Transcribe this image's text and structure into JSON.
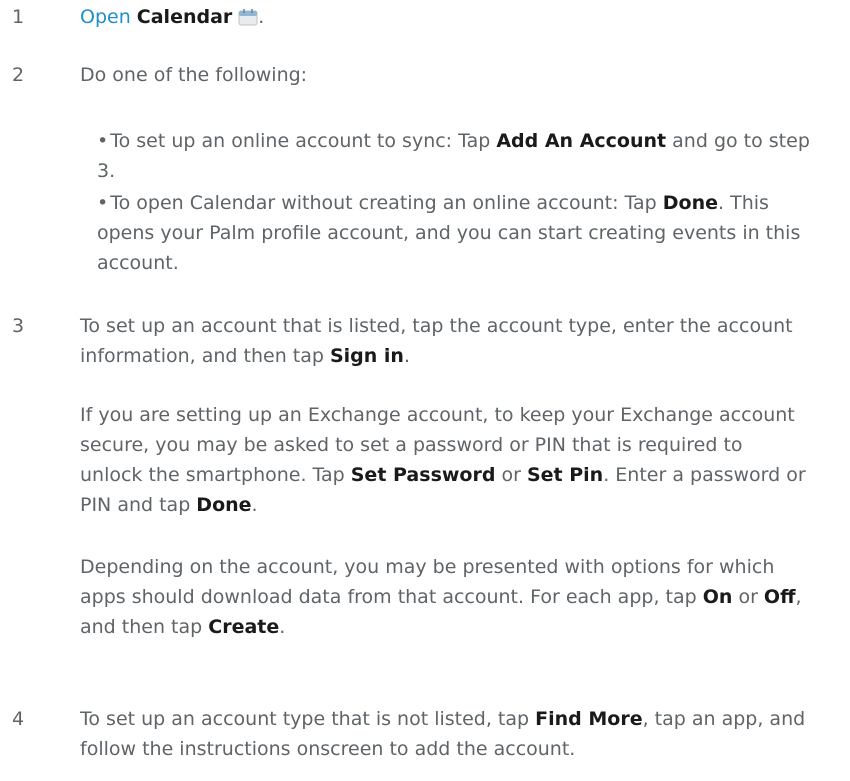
{
  "calendar_icon_name": "calendar-icon",
  "step1": {
    "num": "1",
    "link": "Open",
    "app": "Calendar",
    "end": "."
  },
  "step2": {
    "num": "2",
    "intro": "Do one of the following:",
    "bullet1": {
      "t1": "To set up an online account to sync: Tap ",
      "b1": "Add An Account",
      "t2": " and go to step 3."
    },
    "bullet2": {
      "t1": "To open Calendar without creating an online account: Tap ",
      "b1": "Done",
      "t2": ". This opens your Palm profile account, and you can start creating events in this account."
    }
  },
  "step3": {
    "num": "3",
    "p1": {
      "t1": "To set up an account that is listed, tap the account type, enter the account information, and then tap ",
      "b1": "Sign in",
      "t2": "."
    },
    "p2": {
      "t1": "If you are setting up an Exchange account, to keep your Exchange account secure, you may be asked to set a password or PIN that is required to unlock the smartphone. Tap ",
      "b1": "Set Password",
      "t2": " or ",
      "b2": "Set Pin",
      "t3": ". Enter a password or PIN and tap ",
      "b3": "Done",
      "t4": "."
    },
    "p3": {
      "t1": "Depending on the account, you may be presented with options for which apps should download data from that account. For each app, tap ",
      "b1": "On",
      "t2": " or ",
      "b2": "Off",
      "t3": ", and then tap ",
      "b3": "Create",
      "t4": "."
    }
  },
  "step4": {
    "num": "4",
    "t1": "To set up an account type that is not listed, tap ",
    "b1": "Find More",
    "t2": ", tap an app, and follow the instructions onscreen to add the account."
  }
}
